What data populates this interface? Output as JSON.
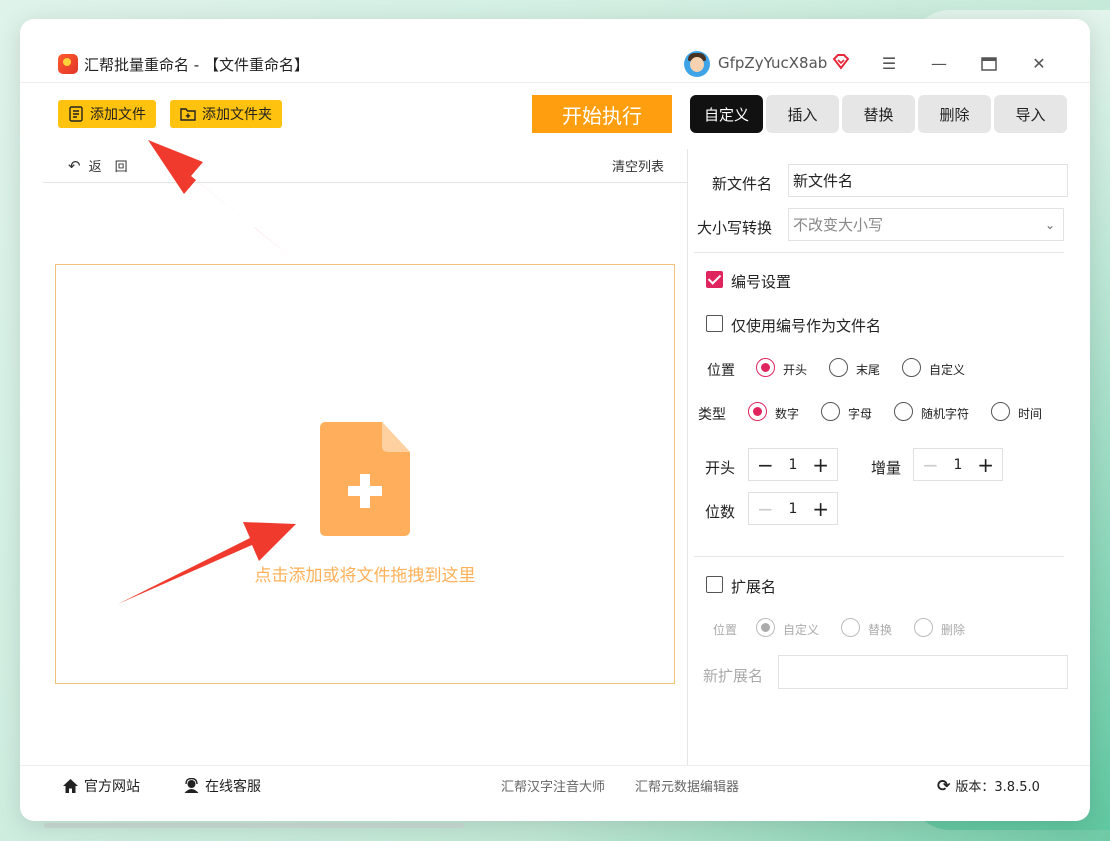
{
  "app": {
    "title": "汇帮批量重命名 - 【文件重命名】",
    "username": "GfpZyYucX8ab",
    "icons": {
      "vip": "diamond-icon",
      "menu": "hamburger-icon",
      "minimize": "minimize-icon",
      "maximize": "maximize-icon",
      "close": "close-icon"
    }
  },
  "toolbar": {
    "add_file": "添加文件",
    "add_folder": "添加文件夹",
    "start": "开始执行",
    "back": "返　回",
    "clear_list": "清空列表"
  },
  "tabs": [
    {
      "label": "自定义",
      "active": true
    },
    {
      "label": "插入",
      "active": false
    },
    {
      "label": "替换",
      "active": false
    },
    {
      "label": "删除",
      "active": false
    },
    {
      "label": "导入",
      "active": false
    }
  ],
  "dropzone": {
    "text": "点击添加或将文件拖拽到这里"
  },
  "panel": {
    "new_name_label": "新文件名",
    "new_name_value": "新文件名",
    "case_label": "大小写转换",
    "case_value": "不改变大小写",
    "numbering": {
      "label": "编号设置",
      "checked": true
    },
    "only_number": {
      "label": "仅使用编号作为文件名",
      "checked": false
    },
    "position_label": "位置",
    "position_options": [
      "开头",
      "末尾",
      "自定义"
    ],
    "position_selected": "开头",
    "type_label": "类型",
    "type_options": [
      "数字",
      "字母",
      "随机字符",
      "时间"
    ],
    "type_selected": "数字",
    "start_label": "开头",
    "start_value": "1",
    "increment_label": "增量",
    "increment_value": "1",
    "digits_label": "位数",
    "digits_value": "1",
    "extension": {
      "label": "扩展名",
      "checked": false
    },
    "ext_position_label": "位置",
    "ext_position_options": [
      "自定义",
      "替换",
      "删除"
    ],
    "ext_position_selected": "自定义",
    "new_ext_label": "新扩展名",
    "new_ext_value": ""
  },
  "footer": {
    "website": "官方网站",
    "support": "在线客服",
    "link1": "汇帮汉字注音大师",
    "link2": "汇帮元数据编辑器",
    "version": "版本：3.8.5.0"
  },
  "colors": {
    "accent": "#ffc20e",
    "start": "#ff9f0f",
    "check": "#e0245e",
    "dropzone_text": "#ffb15a",
    "arrow": "#f03a2e"
  }
}
